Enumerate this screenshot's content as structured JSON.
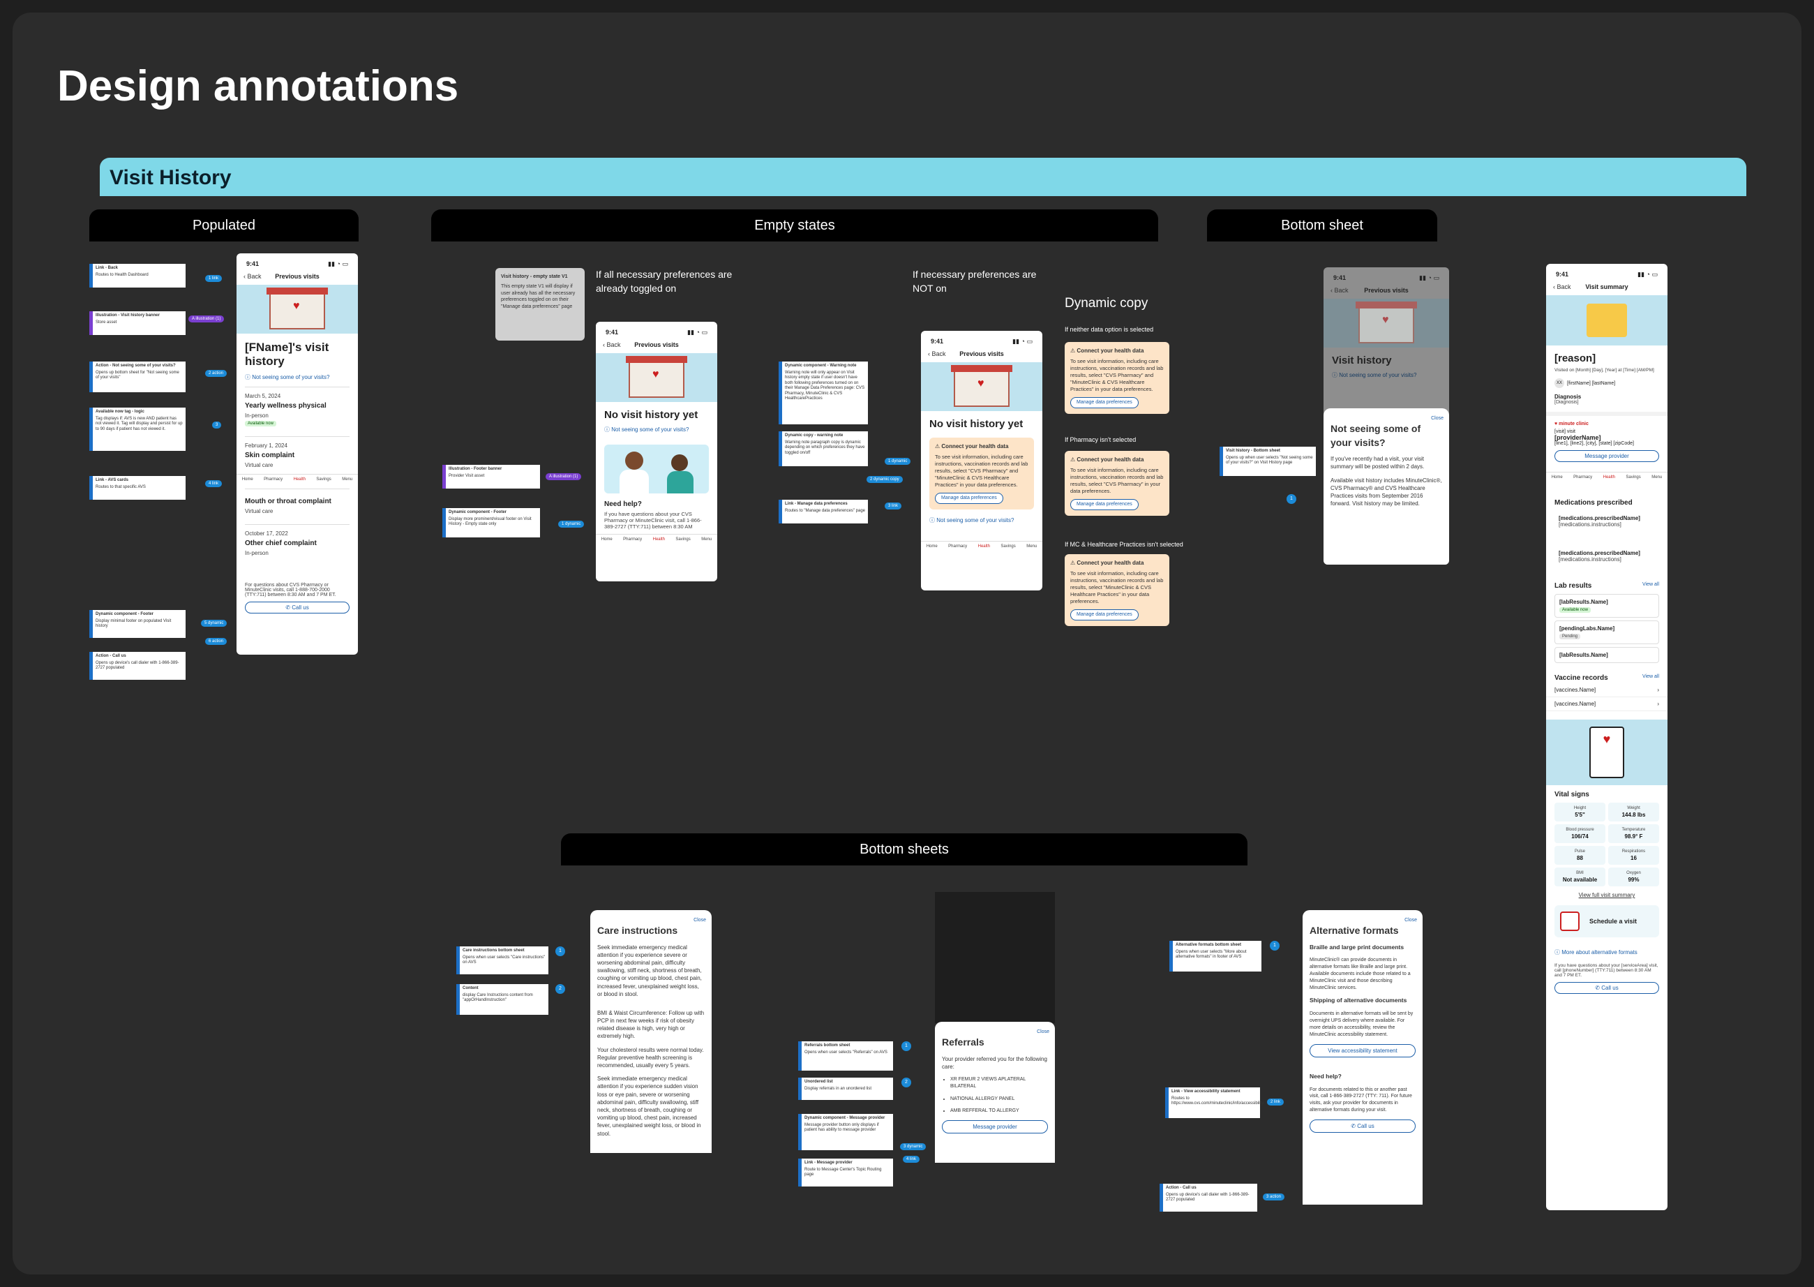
{
  "title": "Design annotations",
  "band": "Visit History",
  "sections": {
    "populated": "Populated",
    "empty": "Empty states",
    "bottom_sheet": "Bottom sheet",
    "bottom_sheets": "Bottom sheets"
  },
  "status_time": "9:41",
  "common": {
    "back": "Back",
    "previous_visits": "Previous visits",
    "not_seeing": "Not seeing some of your visits?",
    "call_us": "Call us",
    "close": "Close",
    "manage": "Manage data preferences",
    "tabs": [
      "Home",
      "Pharmacy",
      "Health",
      "Savings",
      "Menu"
    ]
  },
  "populated": {
    "heading": "[FName]'s visit history",
    "visits": [
      {
        "date": "March 5, 2024",
        "title": "Yearly wellness physical",
        "type": "In-person",
        "tag": "Available now"
      },
      {
        "date": "February 1, 2024",
        "title": "Skin complaint",
        "type": "Virtual care"
      },
      {
        "date": "",
        "title": "Mouth or throat complaint",
        "type": "Virtual care"
      },
      {
        "date": "October 17, 2022",
        "title": "Other chief complaint",
        "type": "In-person"
      }
    ],
    "footer": "For questions about CVS Pharmacy or MinuteClinic visits, call 1-888-700-2000 (TTY:711) between 8:30 AM and 7 PM ET."
  },
  "populated_notes": [
    {
      "t": "Link - Back",
      "d": "Routes to Health Dashboard"
    },
    {
      "t": "Illustration - Visit history banner",
      "d": "Store asset"
    },
    {
      "t": "Action - Not seeing some of your visits?",
      "d": "Opens up bottom sheet for \"Not seeing some of your visits\""
    },
    {
      "t": "Available now tag - logic",
      "d": "Tag displays if: AVS is new AND patient has not viewed it. Tag will display and persist for up to 90 days if patient has not viewed it."
    },
    {
      "t": "Link - AVS cards",
      "d": "Routes to that specific AVS"
    },
    {
      "t": "Dynamic component - Footer",
      "d": "Display minimal footer on populated Visit history"
    },
    {
      "t": "Action - Call us",
      "d": "Opens up device's call dialer with 1-866-389-2727 populated"
    }
  ],
  "populated_pills": [
    "1 link",
    "A illustration (1)",
    "2 action",
    "3",
    "4 link",
    "5 dynamic",
    "6 action"
  ],
  "empty": {
    "gray_title": "Visit history - empty state V1",
    "gray_body": "This empty state V1 will display if user already has all the necessary preferences toggled on on their \"Manage data preferences\" page",
    "toggled_on": "If all necessary preferences are already toggled on",
    "not_on": "If necessary preferences are NOT on",
    "no_history": "No visit history yet",
    "need_help": "Need help?",
    "help_text": "If you have questions about your CVS Pharmacy or MinuteClinic visit, call 1-866-389-2727 (TTY:711) between 8:30 AM",
    "connect_title": "Connect your health data",
    "connect_body": "To see visit information, including care instructions, vaccination records and lab results, select \"CVS Pharmacy\" and \"MinuteClinic & CVS Healthcare Practices\" in your data preferences."
  },
  "empty_notes": [
    {
      "t": "Illustration - Footer banner",
      "d": "Provider Visit asset"
    },
    {
      "t": "Dynamic component - Footer",
      "d": "Display more prominent/visual footer on Visit History - Empty state only"
    },
    {
      "t": "Dynamic component - Warning note",
      "d": "Warning note will only appear on Visit history empty state if user doesn't have both following preferences turned on on their Manage Data Preferences page: CVS Pharmacy, MinuteClinic & CVS HealthcarePractices"
    },
    {
      "t": "Dynamic copy - warning note",
      "d": "Warning note paragraph copy is dynamic depending on which preferences they have toggled on/off"
    },
    {
      "t": "Link - Manage data preferences",
      "d": "Routes to \"Manage data preferences\" page"
    }
  ],
  "empty_pills": [
    "A illustration (1)",
    "1 dynamic",
    "1 dynamic",
    "2 dynamic copy",
    "3 link"
  ],
  "dynamic_copy": {
    "title": "Dynamic copy",
    "items": [
      {
        "label": "If neither data option is selected",
        "body": "To see visit information, including care instructions, vaccination records and lab results, select \"CVS Pharmacy\" and \"MinuteClinic & CVS Healthcare Practices\" in your data preferences."
      },
      {
        "label": "If Pharmacy isn't selected",
        "body": "To see visit information, including care instructions, vaccination records and lab results, select \"CVS Pharmacy\" in your data preferences."
      },
      {
        "label": "If MC & Healthcare Practices isn't selected",
        "body": "To see visit information, including care instructions, vaccination records and lab results, select \"MinuteClinic & CVS Healthcare Practices\" in your data preferences."
      }
    ]
  },
  "bottom_sheet": {
    "heading": "Visit history",
    "sheet_title": "Not seeing some of your visits?",
    "sheet_p1": "If you've recently had a visit, your visit summary will be posted within 2 days.",
    "sheet_p2": "Available visit history includes MinuteClinic®, CVS Pharmacy® and CVS Healthcare Practices visits from September 2016 forward. Visit history may be limited.",
    "note_t": "Visit history - Bottom sheet",
    "note_d": "Opens up when user selects \"Not seeing some of your visits?\" on Visit History page",
    "dot": "1"
  },
  "summary": {
    "nav_title": "Visit summary",
    "reason": "[reason]",
    "visited": "Visited on [Month] [Day], [Year] at [Time] [AM/PM]",
    "initials": "XX",
    "name": "[firstName] [lastName]",
    "diagnosis_label": "Diagnosis",
    "diagnosis": "[Diagnosis]",
    "brand": "minute clinic",
    "visit_type": "[visit] visit",
    "provider": "[providerName]",
    "address": "[line1], [line2], [city], [state] [zipCode]",
    "message_provider": "Message provider",
    "meds_title": "Medications prescribed",
    "meds": [
      {
        "n": "[medications.prescribedName]",
        "i": "[medications.instructions]"
      },
      {
        "n": "[medications.prescribedName]",
        "i": "[medications.instructions]"
      }
    ],
    "labs_title": "Lab results",
    "view_all": "View all",
    "labs": [
      {
        "n": "[labResults.Name]",
        "tag": "Available now"
      },
      {
        "n": "[pendingLabs.Name]",
        "tag": "Pending"
      },
      {
        "n": "[labResults.Name]",
        "tag": ""
      }
    ],
    "vaccines_title": "Vaccine records",
    "vaccines": [
      "[vaccines.Name]",
      "[vaccines.Name]"
    ],
    "vitals_title": "Vital signs",
    "vitals": [
      {
        "l": "Height",
        "v": "5'5\""
      },
      {
        "l": "Weight",
        "v": "144.8 lbs"
      },
      {
        "l": "Blood pressure",
        "v": "106/74"
      },
      {
        "l": "Temperature",
        "v": "98.9° F"
      },
      {
        "l": "Pulse",
        "v": "88"
      },
      {
        "l": "Respirations",
        "v": "16"
      },
      {
        "l": "BMI",
        "v": "Not available"
      },
      {
        "l": "Oxygen",
        "v": "99%"
      }
    ],
    "view_full": "View full visit summary",
    "schedule": "Schedule a visit",
    "alt_formats": "More about alternative formats",
    "footer": "If you have questions about your [serviceArea] visit, call [phoneNumber] (TTY:711) between 8:30 AM and 7 PM ET."
  },
  "care": {
    "title": "Care instructions",
    "p": [
      "Seek immediate emergency medical attention if you experience severe or worsening abdominal pain, difficulty swallowing, stiff neck, shortness of breath, coughing or vomiting up blood, chest pain, increased fever, unexplained weight loss, or blood in stool.",
      "BMI & Waist Circumference: Follow up with PCP in next few weeks if risk of obesity related disease is high, very high or extremely high.",
      "Your cholesterol results were normal today. Regular preventive health screening is recommended, usually every 5 years.",
      "Seek immediate emergency medical attention if you experience sudden vision loss or eye pain, severe or worsening abdominal pain, difficulty swallowing, stiff neck, shortness of breath, coughing or vomiting up blood, chest pain, increased fever, unexplained weight loss, or blood in stool."
    ],
    "notes": [
      {
        "t": "Care instructions bottom sheet",
        "d": "Opens when user selects \"Care instructions\" on AVS"
      },
      {
        "t": "Content",
        "d": "display Care Instructions content from \"appOrHandInstruction\""
      }
    ]
  },
  "referrals": {
    "title": "Referrals",
    "intro": "Your provider referred you for the following care:",
    "items": [
      "XR FEMUR 2 VIEWS APLATERAL BILATERAL",
      "NATIONAL ALLERGY PANEL",
      "AMB REFFERAL TO ALLERGY"
    ],
    "button": "Message provider",
    "notes": [
      {
        "t": "Referrals bottom sheet",
        "d": "Opens when user selects \"Referrals\" on AVS"
      },
      {
        "t": "Unordered list",
        "d": "Display referrals in an unordered list"
      },
      {
        "t": "Dynamic component - Message provider",
        "d": "Message provider button only displays if patient has ability to message provider"
      },
      {
        "t": "Link - Message provider",
        "d": "Route to Message Center's Topic Routing page"
      }
    ]
  },
  "alt": {
    "title": "Alternative formats",
    "h1": "Braille and large print documents",
    "p1": "MinuteClinic® can provide documents in alternative formats like Braille and large print. Available documents include those related to a MinuteClinic visit and those describing MinuteClinic services.",
    "h2": "Shipping of alternative documents",
    "p2": "Documents in alternative formats will be sent by overnight UPS delivery where available. For more details on accessibility, review the MinuteClinic accessibility statement.",
    "btn": "View accessibility statement",
    "help": "Need help?",
    "p3": "For documents related to this or another past visit, call 1-866-389-2727 (TTY: 711). For future visits, ask your provider for documents in alternative formats during your visit.",
    "notes": [
      {
        "t": "Alternative formats bottom sheet",
        "d": "Opens when user selects \"More about alternative formats\" in footer of AVS"
      },
      {
        "t": "Link - View accessibility statement",
        "d": "Routes to https://www.cvs.com/minuteclinic/info/accessibility"
      },
      {
        "t": "Action - Call us",
        "d": "Opens up device's call dialer with 1-866-389-2727 populated"
      }
    ]
  }
}
